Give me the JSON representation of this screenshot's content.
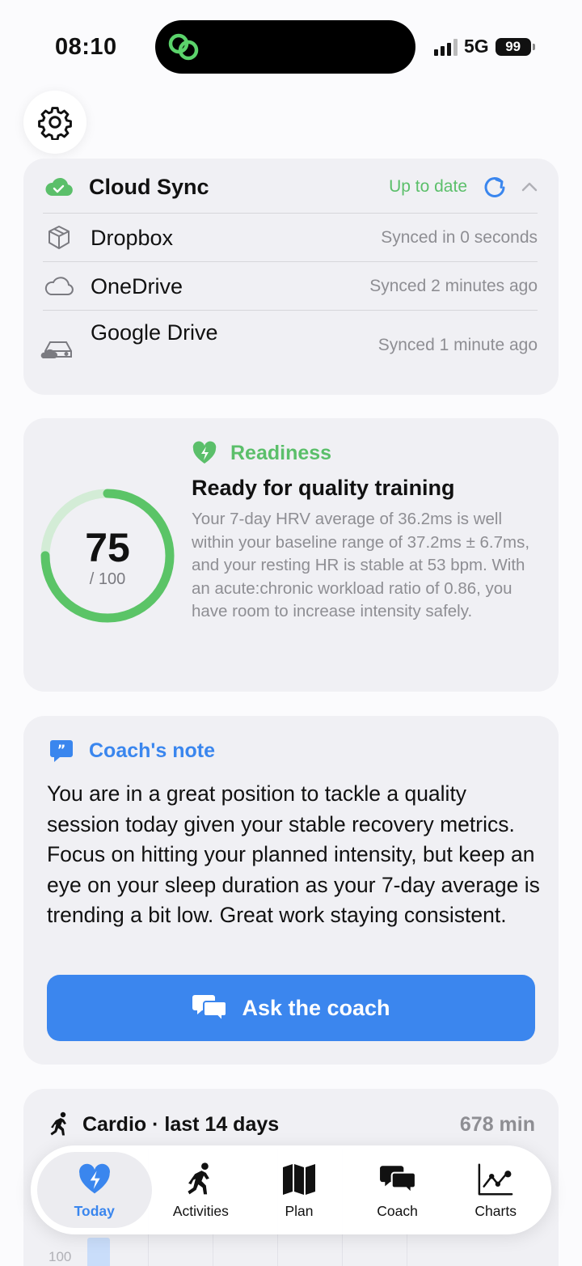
{
  "status_bar": {
    "time": "08:10",
    "network": "5G",
    "battery": "99"
  },
  "sync": {
    "title": "Cloud Sync",
    "status": "Up to date",
    "status_color": "#5bbf6a",
    "providers": [
      {
        "name": "Dropbox",
        "status": "Synced in 0 seconds",
        "icon": "box-icon"
      },
      {
        "name": "OneDrive",
        "status": "Synced 2 minutes ago",
        "icon": "cloud-outline-icon"
      },
      {
        "name": "Google Drive",
        "status": "Synced 1 minute ago",
        "icon": "drive-icon"
      }
    ]
  },
  "readiness": {
    "label": "Readiness",
    "score": "75",
    "score_max": "/ 100",
    "score_value": 75,
    "score_total": 100,
    "title": "Ready for quality training",
    "body": "Your 7-day HRV average of 36.2ms is well within your baseline range of 37.2ms ± 6.7ms, and your resting HR is stable at 53 bpm. With an acute:chronic workload ratio of 0.86, you have room to increase intensity safely.",
    "accent": "#5bbf6a"
  },
  "coach_note": {
    "label": "Coach's note",
    "body": "You are in a great position to tackle a quality session today given your stable recovery metrics. Focus on hitting your planned intensity, but keep an eye on your sleep duration as your 7-day average is trending a bit low. Great work staying consistent.",
    "button": "Ask the coach",
    "accent": "#3b86ee"
  },
  "cardio": {
    "title": "Cardio · last 14 days",
    "total": "678 min",
    "tick_label": "100"
  },
  "tabs": [
    {
      "label": "Today",
      "icon": "heart-bolt-icon",
      "active": true
    },
    {
      "label": "Activities",
      "icon": "runner-icon",
      "active": false
    },
    {
      "label": "Plan",
      "icon": "map-icon",
      "active": false
    },
    {
      "label": "Coach",
      "icon": "chat-bubbles-icon",
      "active": false
    },
    {
      "label": "Charts",
      "icon": "line-chart-icon",
      "active": false
    }
  ]
}
